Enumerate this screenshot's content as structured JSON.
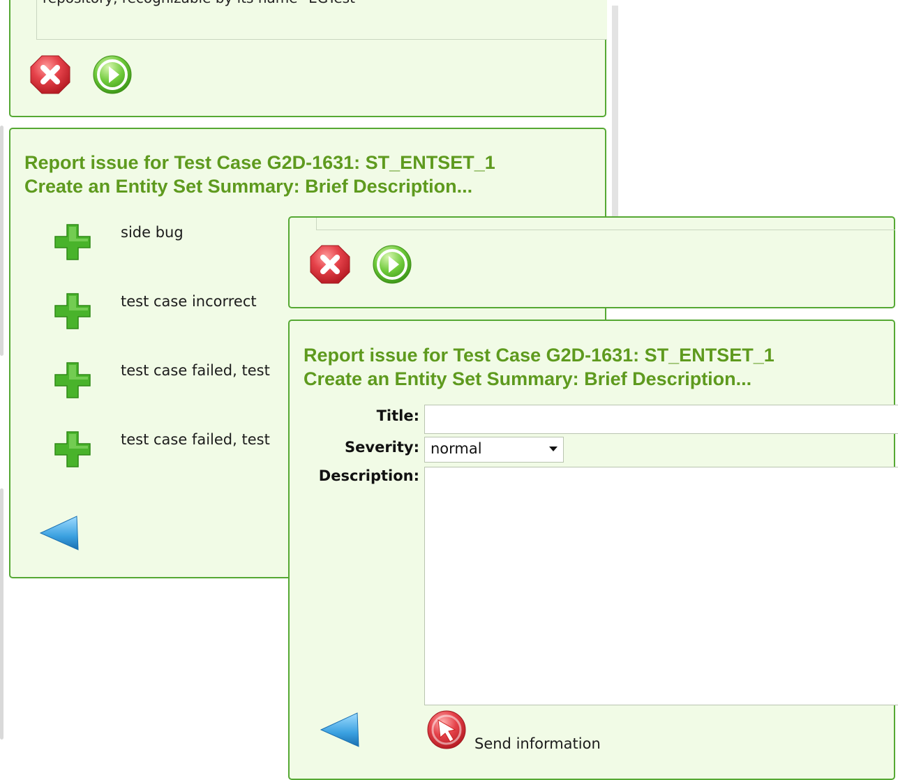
{
  "back_window": {
    "top_panel": {
      "text_snippet": "repository, recognizable by its name \"EGTest\""
    },
    "report_panel": {
      "heading_line1": "Report issue for Test Case G2D-1631: ST_ENTSET_1",
      "heading_line2": "Create an Entity Set Summary: Brief Description...",
      "options": [
        {
          "label": "side bug",
          "icon": "plus-icon"
        },
        {
          "label": "test case incorrect",
          "icon": "plus-icon"
        },
        {
          "label": "test case failed, test",
          "icon": "plus-icon"
        },
        {
          "label": "test case failed, test",
          "icon": "plus-icon"
        }
      ]
    }
  },
  "front_window": {
    "report_panel": {
      "heading_line1": "Report issue for Test Case G2D-1631: ST_ENTSET_1",
      "heading_line2": "Create an Entity Set Summary: Brief Description...",
      "form": {
        "title_label": "Title:",
        "title_value": "",
        "severity_label": "Severity:",
        "severity_value": "normal",
        "description_label": "Description:",
        "description_value": ""
      },
      "send_label": "Send information"
    }
  },
  "colors": {
    "panel_bg": "#f1fbe6",
    "panel_border": "#55a833",
    "heading": "#5e9a1e",
    "cancel_red": "#e0353d",
    "go_green": "#5bbd2a",
    "plus_green": "#49b32b",
    "back_blue": "#3aa0e0"
  }
}
